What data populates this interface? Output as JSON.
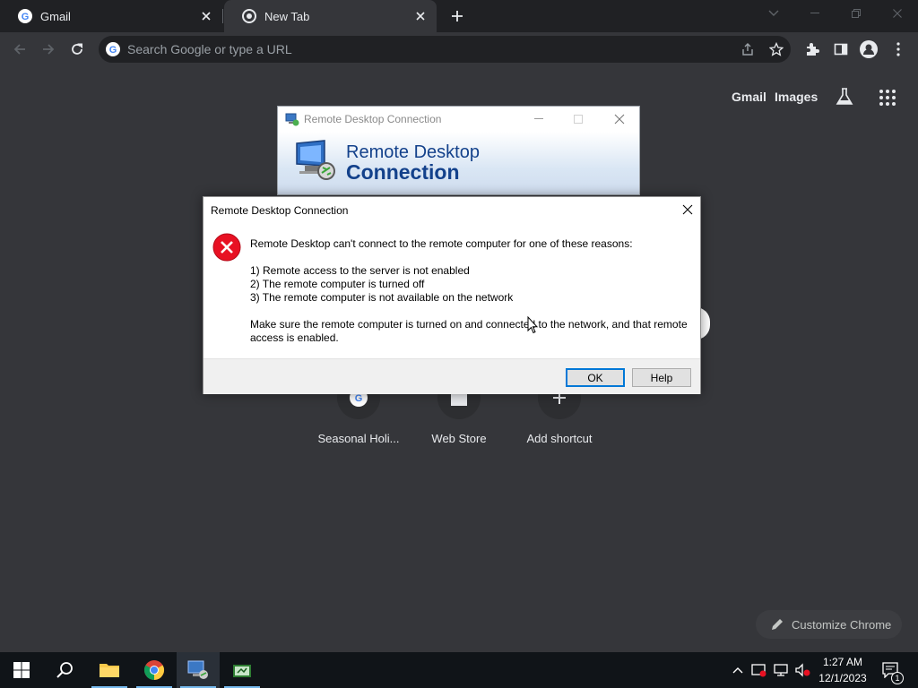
{
  "browser": {
    "tabs": [
      {
        "title": "Gmail",
        "active": false
      },
      {
        "title": "New Tab",
        "active": true
      }
    ],
    "omnibox": {
      "placeholder": "Search Google or type a URL",
      "value": ""
    }
  },
  "ntp": {
    "header_links": [
      "Gmail",
      "Images"
    ],
    "shortcuts": [
      {
        "label": "Seasonal Holi..."
      },
      {
        "label": "Web Store"
      },
      {
        "label": "Add shortcut"
      }
    ],
    "customize_label": "Customize Chrome"
  },
  "rdc_window": {
    "title": "Remote Desktop Connection",
    "banner_line1": "Remote Desktop",
    "banner_line2": "Connection"
  },
  "error_dialog": {
    "title": "Remote Desktop Connection",
    "message": "Remote Desktop can't connect to the remote computer for one of these reasons:",
    "reasons": [
      "1) Remote access to the server is not enabled",
      "2) The remote computer is turned off",
      "3) The remote computer is not available on the network"
    ],
    "advice_line1": "Make sure the remote computer is turned on and connected to the network, and that remote",
    "advice_line2": "access is enabled.",
    "ok_label": "OK",
    "help_label": "Help"
  },
  "taskbar": {
    "time": "1:27 AM",
    "date": "12/1/2023",
    "notification_count": "1"
  },
  "colors": {
    "chrome_bg": "#35363a",
    "tabstrip_bg": "#202124",
    "dialog_accent": "#0078d7",
    "error_red": "#e81123",
    "rdc_blue": "#13418b"
  }
}
